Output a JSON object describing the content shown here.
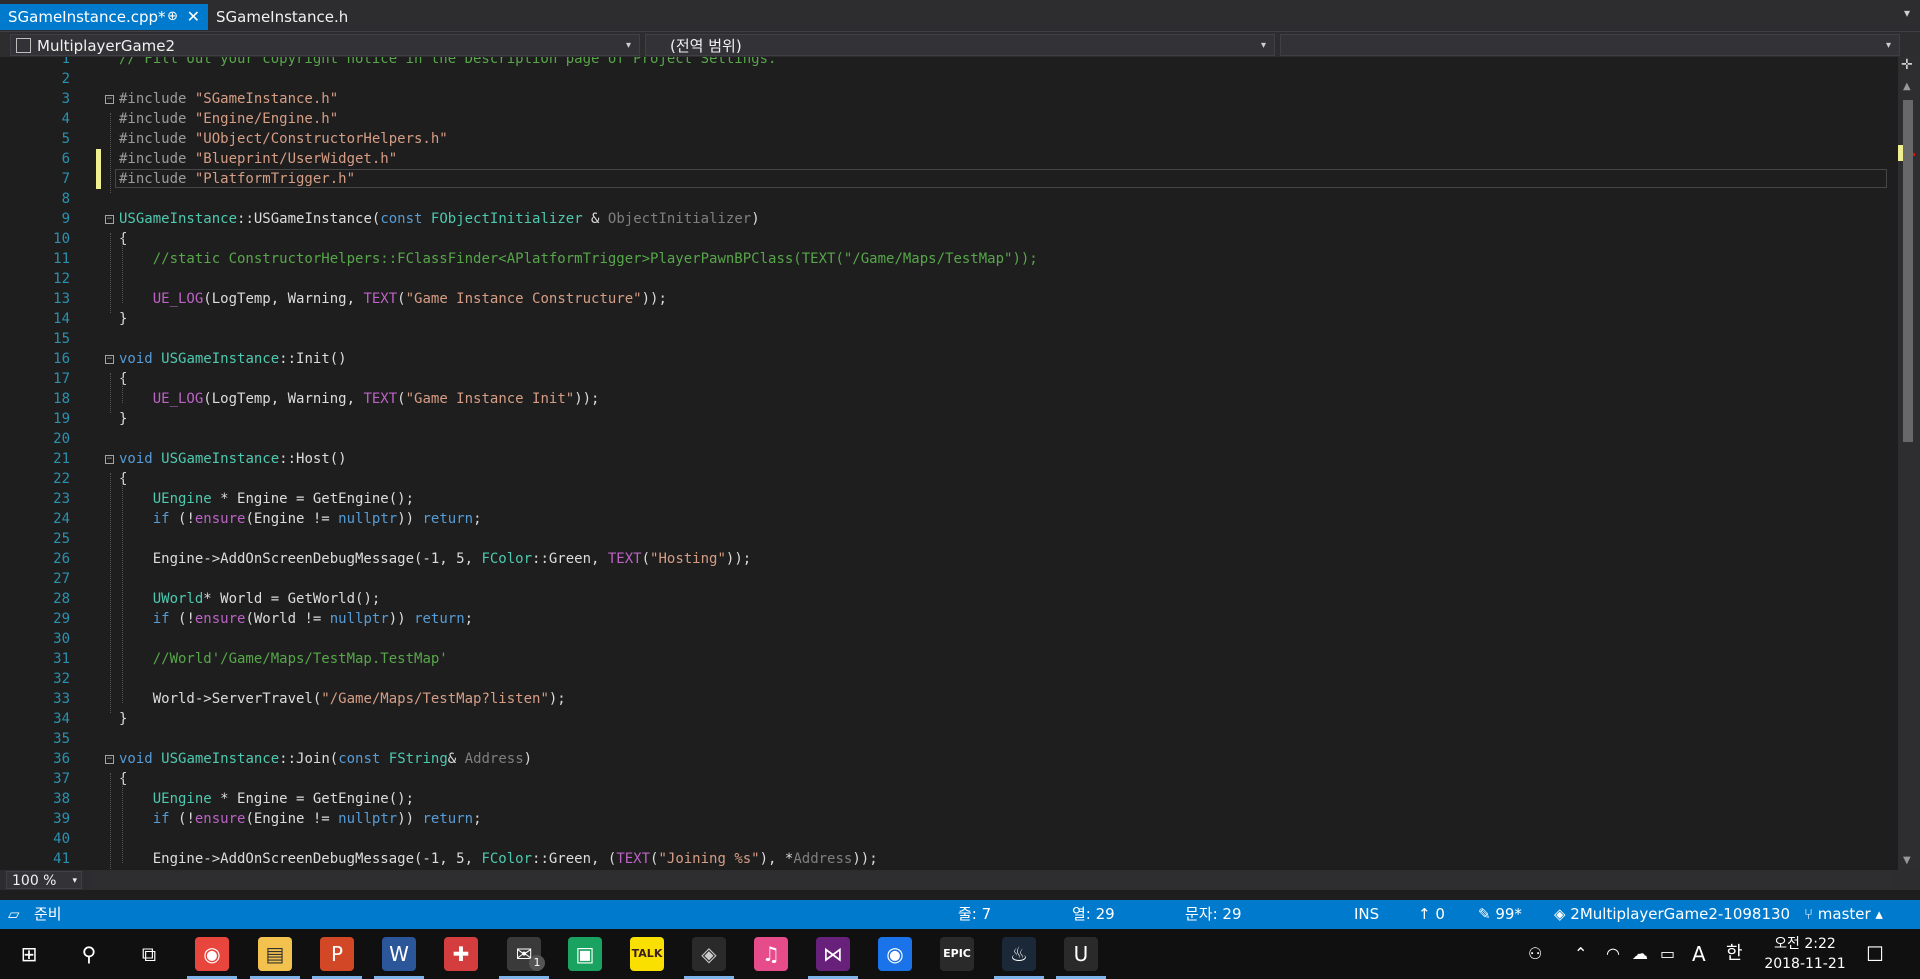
{
  "tabs": {
    "active": "SGameInstance.cpp*",
    "active_pin": "⊕",
    "active_close": "✕",
    "inactive": "SGameInstance.h",
    "overflow": "▾"
  },
  "nav": {
    "project": "MultiplayerGame2",
    "scope": "(전역 범위)",
    "member": "",
    "split": "✛",
    "arrow": "▾"
  },
  "code": {
    "line_numbers": [
      "1",
      "2",
      "3",
      "4",
      "5",
      "6",
      "7",
      "8",
      "9",
      "10",
      "11",
      "12",
      "13",
      "14",
      "15",
      "16",
      "17",
      "18",
      "19",
      "20",
      "21",
      "22",
      "23",
      "24",
      "25",
      "26",
      "27",
      "28",
      "29",
      "30",
      "31",
      "32",
      "33",
      "34",
      "35",
      "36",
      "37",
      "38",
      "39",
      "40",
      "41"
    ],
    "lines": [
      [
        [
          "c",
          "// Fill out your copyright notice in the Description page of Project Settings."
        ]
      ],
      [],
      [
        [
          "p",
          "#include "
        ],
        [
          "s",
          "\"SGameInstance.h\""
        ]
      ],
      [
        [
          "p",
          "#include "
        ],
        [
          "s",
          "\"Engine/Engine.h\""
        ]
      ],
      [
        [
          "p",
          "#include "
        ],
        [
          "s",
          "\"UObject/ConstructorHelpers.h\""
        ]
      ],
      [
        [
          "p",
          "#include "
        ],
        [
          "s",
          "\"Blueprint/UserWidget.h\""
        ]
      ],
      [
        [
          "p",
          "#include "
        ],
        [
          "s",
          "\"PlatformTrigger.h\""
        ]
      ],
      [],
      [
        [
          "t",
          "USGameInstance"
        ],
        [
          "o",
          "::"
        ],
        [
          "f",
          "USGameInstance"
        ],
        [
          "o",
          "("
        ],
        [
          "k",
          "const "
        ],
        [
          "t",
          "FObjectInitializer"
        ],
        [
          "o",
          " & "
        ],
        [
          "g",
          "ObjectInitializer"
        ],
        [
          "o",
          ")"
        ]
      ],
      [
        [
          "o",
          "{"
        ]
      ],
      [
        [
          "o",
          "    "
        ],
        [
          "c",
          "//static ConstructorHelpers::FClassFinder<APlatformTrigger>PlayerPawnBPClass(TEXT(\"/Game/Maps/TestMap\"));"
        ]
      ],
      [],
      [
        [
          "o",
          "    "
        ],
        [
          "m",
          "UE_LOG"
        ],
        [
          "o",
          "(LogTemp, Warning, "
        ],
        [
          "m",
          "TEXT"
        ],
        [
          "o",
          "("
        ],
        [
          "s",
          "\"Game Instance Constructure\""
        ],
        [
          "o",
          "));"
        ]
      ],
      [
        [
          "o",
          "}"
        ]
      ],
      [],
      [
        [
          "k",
          "void "
        ],
        [
          "t",
          "USGameInstance"
        ],
        [
          "o",
          "::"
        ],
        [
          "f",
          "Init"
        ],
        [
          "o",
          "()"
        ]
      ],
      [
        [
          "o",
          "{"
        ]
      ],
      [
        [
          "o",
          "    "
        ],
        [
          "m",
          "UE_LOG"
        ],
        [
          "o",
          "(LogTemp, Warning, "
        ],
        [
          "m",
          "TEXT"
        ],
        [
          "o",
          "("
        ],
        [
          "s",
          "\"Game Instance Init\""
        ],
        [
          "o",
          "));"
        ]
      ],
      [
        [
          "o",
          "}"
        ]
      ],
      [],
      [
        [
          "k",
          "void "
        ],
        [
          "t",
          "USGameInstance"
        ],
        [
          "o",
          "::"
        ],
        [
          "f",
          "Host"
        ],
        [
          "o",
          "()"
        ]
      ],
      [
        [
          "o",
          "{"
        ]
      ],
      [
        [
          "o",
          "    "
        ],
        [
          "t",
          "UEngine"
        ],
        [
          "o",
          " * Engine = GetEngine();"
        ]
      ],
      [
        [
          "o",
          "    "
        ],
        [
          "k",
          "if "
        ],
        [
          "o",
          "(!"
        ],
        [
          "m",
          "ensure"
        ],
        [
          "o",
          "(Engine != "
        ],
        [
          "k",
          "nullptr"
        ],
        [
          "o",
          ")) "
        ],
        [
          "k",
          "return"
        ],
        [
          "o",
          ";"
        ]
      ],
      [],
      [
        [
          "o",
          "    Engine->AddOnScreenDebugMessage(-1, 5, "
        ],
        [
          "t",
          "FColor"
        ],
        [
          "o",
          "::Green, "
        ],
        [
          "m",
          "TEXT"
        ],
        [
          "o",
          "("
        ],
        [
          "s",
          "\"Hosting\""
        ],
        [
          "o",
          "));"
        ]
      ],
      [],
      [
        [
          "o",
          "    "
        ],
        [
          "t",
          "UWorld"
        ],
        [
          "o",
          "* World = GetWorld();"
        ]
      ],
      [
        [
          "o",
          "    "
        ],
        [
          "k",
          "if "
        ],
        [
          "o",
          "(!"
        ],
        [
          "m",
          "ensure"
        ],
        [
          "o",
          "(World != "
        ],
        [
          "k",
          "nullptr"
        ],
        [
          "o",
          ")) "
        ],
        [
          "k",
          "return"
        ],
        [
          "o",
          ";"
        ]
      ],
      [],
      [
        [
          "o",
          "    "
        ],
        [
          "c",
          "//World'/Game/Maps/TestMap.TestMap'"
        ]
      ],
      [],
      [
        [
          "o",
          "    World->ServerTravel("
        ],
        [
          "s",
          "\"/Game/Maps/TestMap?listen\""
        ],
        [
          "o",
          ");"
        ]
      ],
      [
        [
          "o",
          "}"
        ]
      ],
      [],
      [
        [
          "k",
          "void "
        ],
        [
          "t",
          "USGameInstance"
        ],
        [
          "o",
          "::"
        ],
        [
          "f",
          "Join"
        ],
        [
          "o",
          "("
        ],
        [
          "k",
          "const "
        ],
        [
          "t",
          "FString"
        ],
        [
          "o",
          "& "
        ],
        [
          "g",
          "Address"
        ],
        [
          "o",
          ")"
        ]
      ],
      [
        [
          "o",
          "{"
        ]
      ],
      [
        [
          "o",
          "    "
        ],
        [
          "t",
          "UEngine"
        ],
        [
          "o",
          " * Engine = GetEngine();"
        ]
      ],
      [
        [
          "o",
          "    "
        ],
        [
          "k",
          "if "
        ],
        [
          "o",
          "(!"
        ],
        [
          "m",
          "ensure"
        ],
        [
          "o",
          "(Engine != "
        ],
        [
          "k",
          "nullptr"
        ],
        [
          "o",
          ")) "
        ],
        [
          "k",
          "return"
        ],
        [
          "o",
          ";"
        ]
      ],
      [],
      [
        [
          "o",
          "    Engine->AddOnScreenDebugMessage(-1, 5, "
        ],
        [
          "t",
          "FColor"
        ],
        [
          "o",
          "::Green, ("
        ],
        [
          "m",
          "TEXT"
        ],
        [
          "o",
          "("
        ],
        [
          "s",
          "\"Joining %s\""
        ],
        [
          "o",
          "), *"
        ],
        [
          "g",
          "Address"
        ],
        [
          "o",
          "));"
        ]
      ]
    ]
  },
  "colors": {
    "c": "#57a64a",
    "p": "#9b9b9b",
    "s": "#d69d85",
    "t": "#4ec9b0",
    "k": "#569cd6",
    "f": "#dcdcdc",
    "o": "#dcdcdc",
    "g": "#7f7f7f",
    "m": "#bd63c5",
    "accent": "#007acc"
  },
  "zoom": {
    "value": "100 %",
    "arrow": "▾"
  },
  "status": {
    "ready_icon": "▱",
    "ready": "준비",
    "line": "줄: 7",
    "col": "열: 29",
    "char": "문자: 29",
    "ins": "INS",
    "up_count": "↑ 0",
    "pending": "✎ 99*",
    "repo": "◈ 2MultiplayerGame2-1098130",
    "branch": "⑂ master ▴"
  },
  "taskbar": {
    "icons": [
      "windows-start-icon",
      "search-icon",
      "task-view-icon",
      "chrome-icon",
      "file-explorer-icon",
      "powerpoint-icon",
      "word-icon",
      "app-red-icon",
      "mail-icon",
      "app-green-icon",
      "kakaotalk-icon",
      "app-dark-icon",
      "itunes-icon",
      "visual-studio-icon",
      "maps-icon",
      "epic-games-icon",
      "steam-icon",
      "unreal-engine-icon"
    ],
    "glyphs": [
      "⊞",
      "⚲",
      "⧉",
      "◉",
      "▤",
      "P",
      "W",
      "✚",
      "✉",
      "▣",
      "TALK",
      "◈",
      "♫",
      "⋈",
      "◉",
      "EPIC",
      "♨",
      "U"
    ],
    "mail_badge": "1",
    "tray": {
      "person": "⚇",
      "up": "⌃",
      "wifi": "◠",
      "cloud": "☁",
      "battery": "▭",
      "ime_a": "A",
      "ime_han": "한",
      "notify": "☐"
    },
    "clock_time": "오전 2:22",
    "clock_date": "2018-11-21"
  }
}
